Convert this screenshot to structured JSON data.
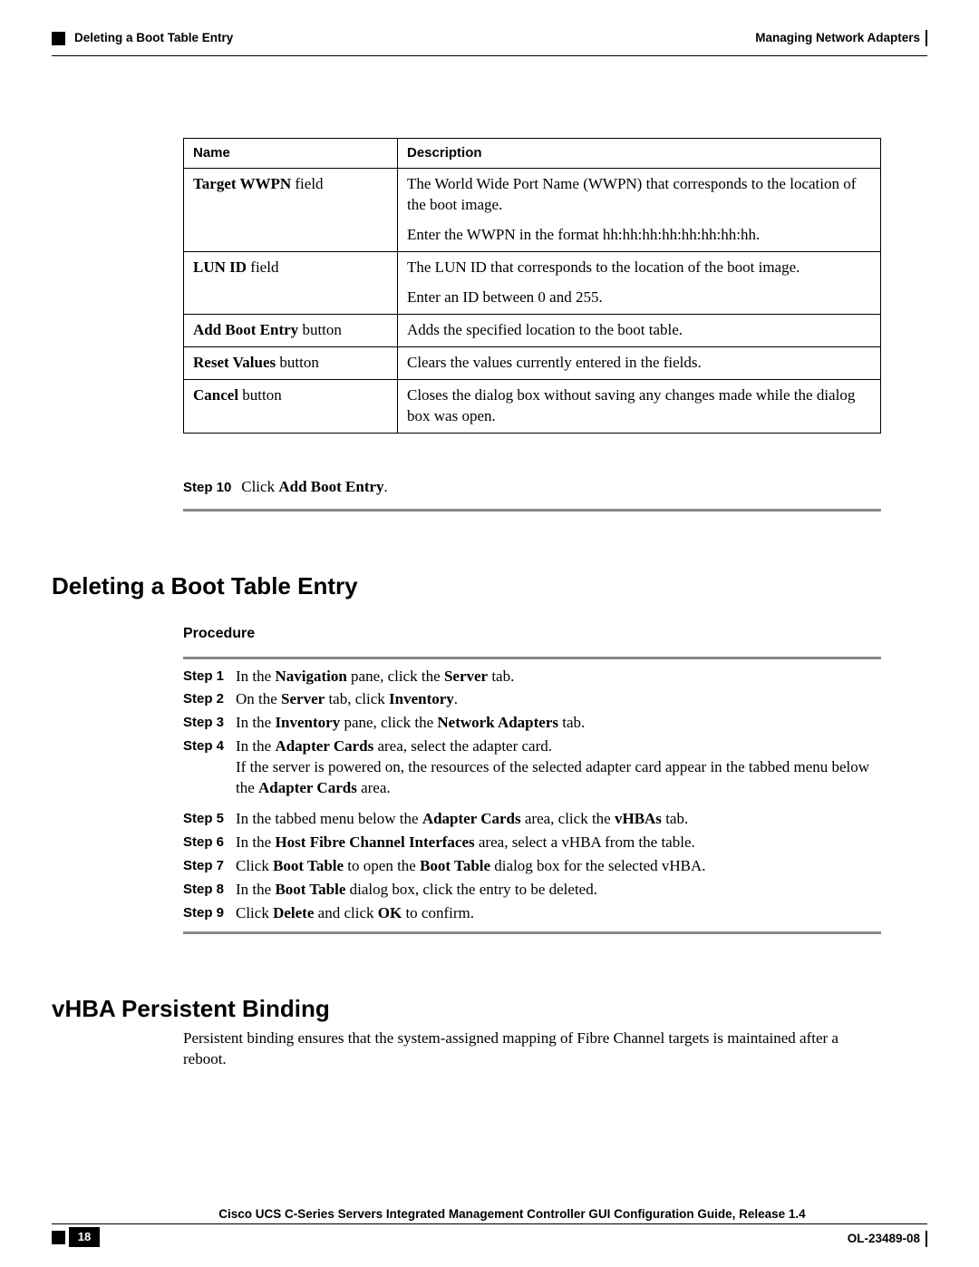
{
  "header": {
    "left": "Deleting a Boot Table Entry",
    "right": "Managing Network Adapters"
  },
  "table": {
    "head": {
      "c1": "Name",
      "c2": "Description"
    },
    "rows": [
      {
        "name_bold": "Target WWPN",
        "name_rest": " field",
        "desc1": "The World Wide Port Name (WWPN) that corresponds to the location of the boot image.",
        "desc2": "Enter the WWPN in the format hh:hh:hh:hh:hh:hh:hh:hh."
      },
      {
        "name_bold": "LUN ID",
        "name_rest": " field",
        "desc1": "The LUN ID that corresponds to the location of the boot image.",
        "desc2": "Enter an ID between 0 and 255."
      },
      {
        "name_bold": "Add Boot Entry",
        "name_rest": " button",
        "desc1": "Adds the specified location to the boot table.",
        "desc2": ""
      },
      {
        "name_bold": "Reset Values",
        "name_rest": " button",
        "desc1": "Clears the values currently entered in the fields.",
        "desc2": ""
      },
      {
        "name_bold": "Cancel",
        "name_rest": " button",
        "desc1": "Closes the dialog box without saving any changes made while the dialog box was open.",
        "desc2": ""
      }
    ]
  },
  "step10": {
    "label": "Step 10",
    "pre": "Click ",
    "bold": "Add Boot Entry",
    "post": "."
  },
  "section1": {
    "title": "Deleting a Boot Table Entry",
    "sub": "Procedure",
    "steps": [
      {
        "n": "Step 1",
        "parts": [
          "In the ",
          "Navigation",
          " pane, click the ",
          "Server",
          " tab."
        ]
      },
      {
        "n": "Step 2",
        "parts": [
          "On the ",
          "Server",
          " tab, click ",
          "Inventory",
          "."
        ]
      },
      {
        "n": "Step 3",
        "parts": [
          "In the ",
          "Inventory",
          " pane, click the ",
          "Network Adapters",
          " tab."
        ]
      },
      {
        "n": "Step 4",
        "parts": [
          "In the ",
          "Adapter Cards",
          " area, select the adapter card."
        ],
        "extra_parts": [
          "If the server is powered on, the resources of the selected adapter card appear in the tabbed menu below the ",
          "Adapter Cards",
          " area."
        ]
      },
      {
        "n": "Step 5",
        "parts": [
          "In the tabbed menu below the ",
          "Adapter Cards",
          " area, click the ",
          "vHBAs",
          " tab."
        ]
      },
      {
        "n": "Step 6",
        "parts": [
          "In the ",
          "Host Fibre Channel Interfaces",
          " area, select a vHBA from the table."
        ]
      },
      {
        "n": "Step 7",
        "parts": [
          "Click ",
          "Boot Table",
          " to open the ",
          "Boot Table",
          " dialog box for the selected vHBA."
        ]
      },
      {
        "n": "Step 8",
        "parts": [
          "In the ",
          "Boot Table",
          " dialog box, click the entry to be deleted."
        ]
      },
      {
        "n": "Step 9",
        "parts": [
          "Click ",
          "Delete",
          " and click ",
          "OK",
          " to confirm."
        ]
      }
    ]
  },
  "section2": {
    "title": "vHBA Persistent Binding",
    "para": "Persistent binding ensures that the system-assigned mapping of Fibre Channel targets is maintained after a reboot."
  },
  "footer": {
    "title": "Cisco UCS C-Series Servers Integrated Management Controller GUI Configuration Guide, Release 1.4",
    "page": "18",
    "doc": "OL-23489-08"
  }
}
